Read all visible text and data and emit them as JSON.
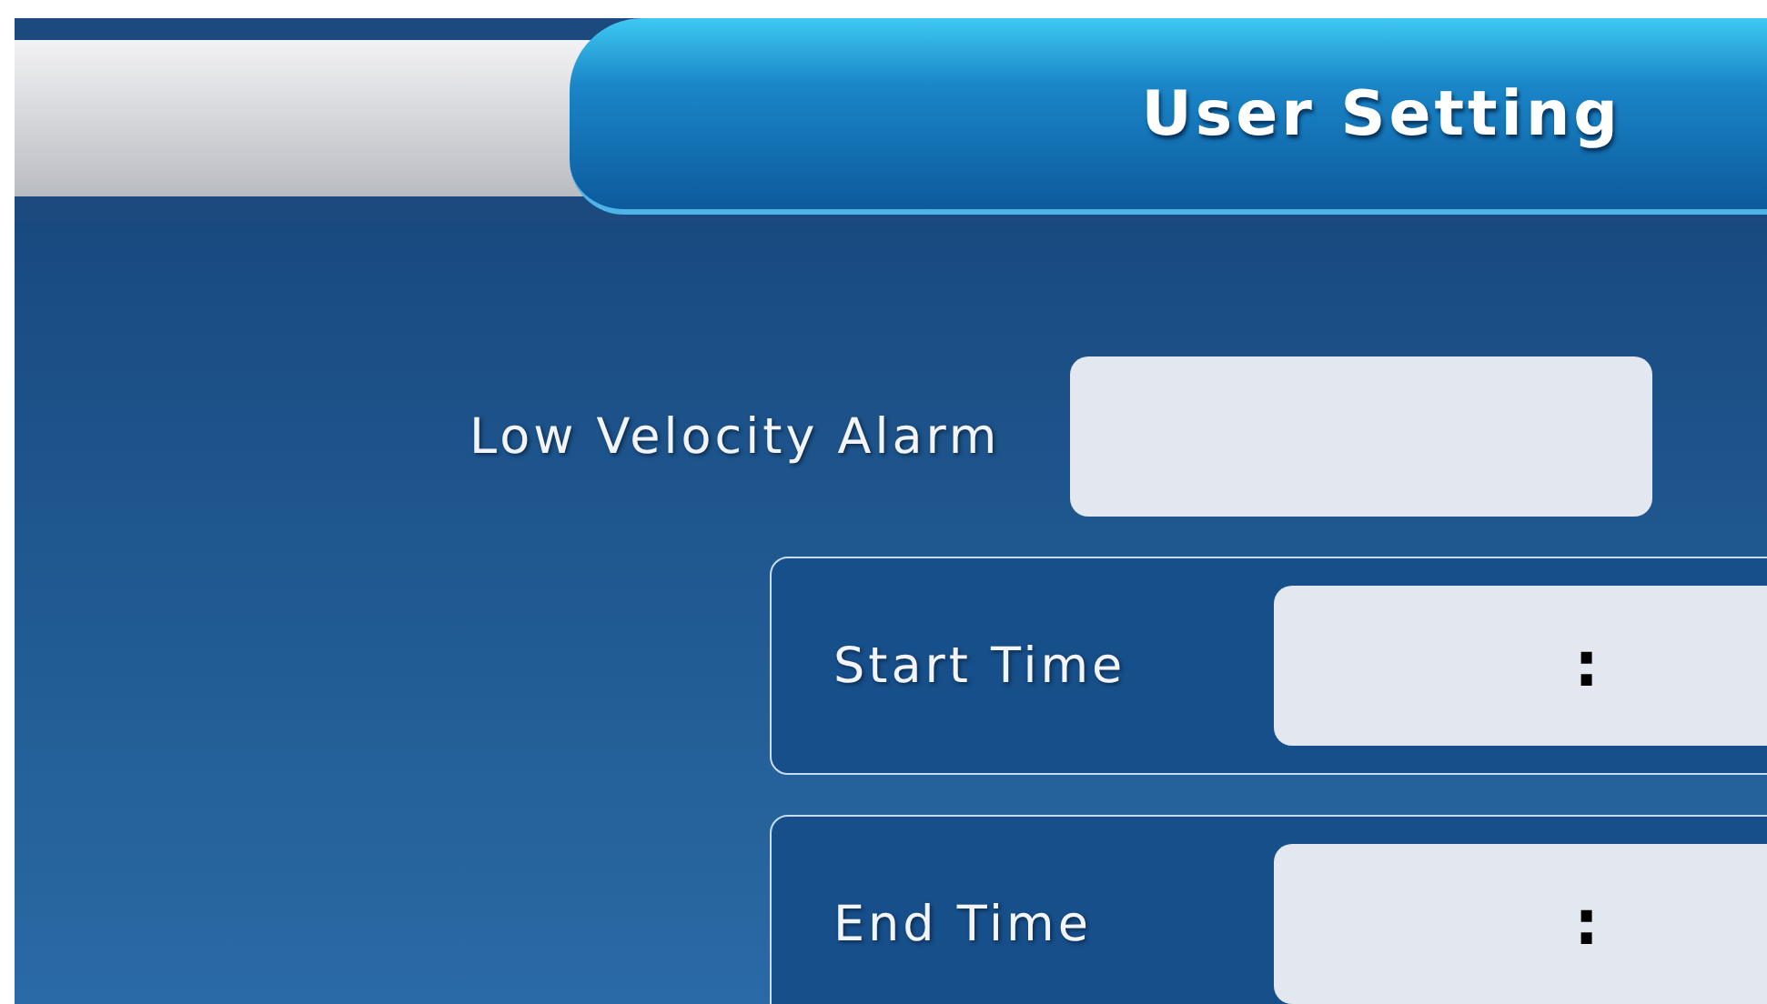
{
  "header": {
    "title": "User Setting"
  },
  "alarm": {
    "label": "Low Velocity Alarm"
  },
  "time_groups": [
    {
      "label": "Start Time",
      "separator": ":"
    },
    {
      "label": "End Time",
      "separator": ":"
    }
  ]
}
